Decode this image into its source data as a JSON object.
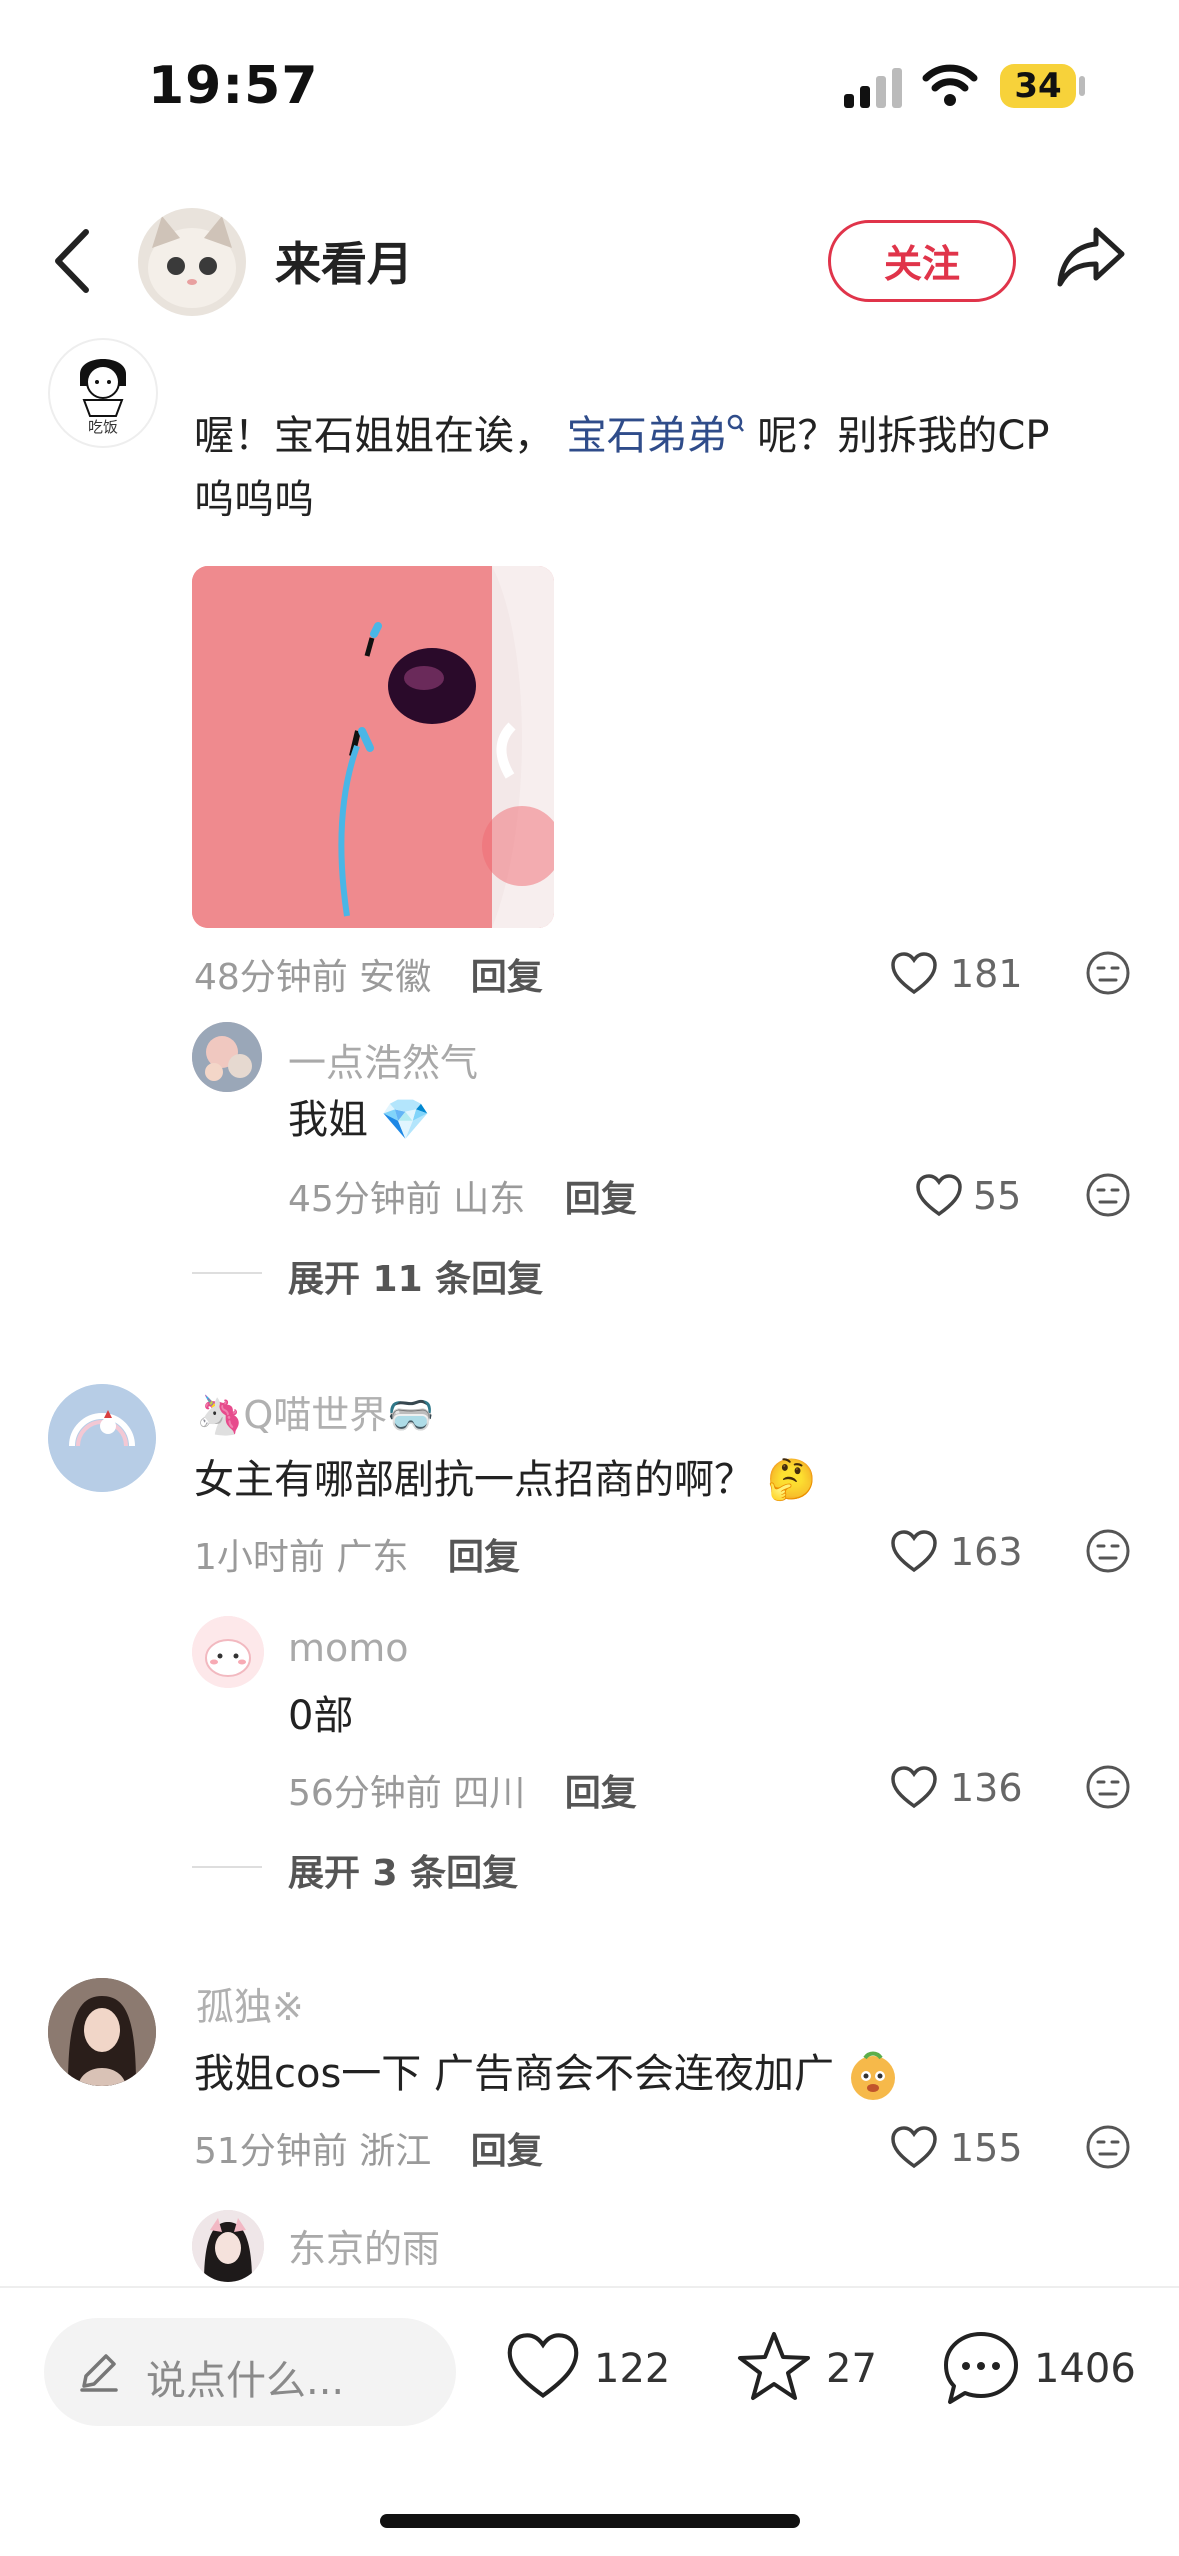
{
  "status_bar": {
    "time": "19:57",
    "battery": "34"
  },
  "header": {
    "username": "来看月",
    "follow_label": "关注"
  },
  "comments": [
    {
      "nickname": "",
      "text_prefix": "喔！宝石姐姐在诶， ",
      "text_link": "宝石弟弟",
      "text_suffix": " 呢？别拆我的CP",
      "text_line2": "呜呜呜",
      "avatar_label": "吃饭",
      "time": "48分钟前",
      "location": "安徽",
      "reply_label": "回复",
      "likes": "181",
      "replies": [
        {
          "nickname": "一点浩然气",
          "text": "我姐",
          "emoji": "💎",
          "time": "45分钟前",
          "location": "山东",
          "reply_label": "回复",
          "likes": "55"
        }
      ],
      "expand_label": "展开 11 条回复"
    },
    {
      "nickname": "🦄Q喵世界🥽",
      "text": "女主有哪部剧抗一点招商的啊？",
      "emoji": "🤔",
      "time": "1小时前",
      "location": "广东",
      "reply_label": "回复",
      "likes": "163",
      "replies": [
        {
          "nickname": "momo",
          "text": "0部",
          "time": "56分钟前",
          "location": "四川",
          "reply_label": "回复",
          "likes": "136"
        }
      ],
      "expand_label": "展开 3 条回复"
    },
    {
      "nickname": "孤独※",
      "text": "我姐cos一下 广告商会不会连夜加广",
      "time": "51分钟前",
      "location": "浙江",
      "reply_label": "回复",
      "likes": "155",
      "replies": [
        {
          "nickname": "东京的雨"
        }
      ]
    }
  ],
  "bottom_bar": {
    "input_placeholder": "说点什么...",
    "likes": "122",
    "stars": "27",
    "comments": "1406"
  }
}
